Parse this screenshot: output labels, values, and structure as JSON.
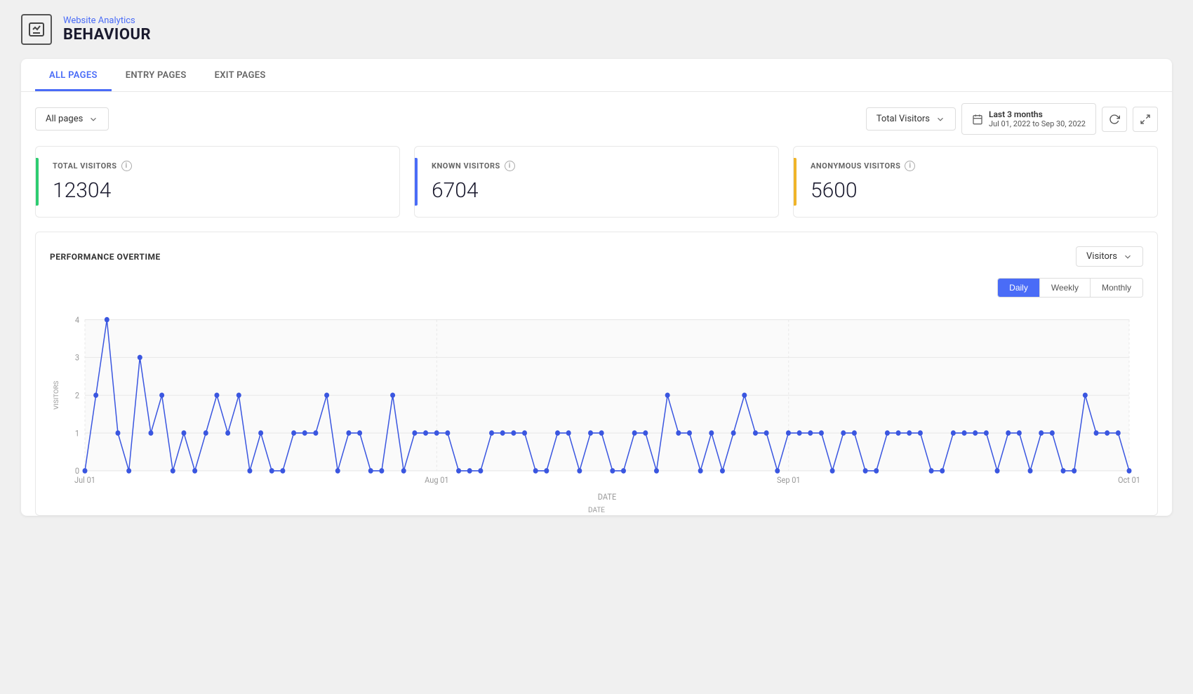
{
  "header": {
    "breadcrumb": "Website Analytics",
    "title": "BEHAVIOUR",
    "icon": "chart-icon"
  },
  "tabs": [
    {
      "id": "all-pages",
      "label": "ALL PAGES",
      "active": true
    },
    {
      "id": "entry-pages",
      "label": "ENTRY PAGES",
      "active": false
    },
    {
      "id": "exit-pages",
      "label": "EXIT PAGES",
      "active": false
    }
  ],
  "controls": {
    "filter_label": "All pages",
    "metric_label": "Total Visitors",
    "date_range_title": "Last 3 months",
    "date_start": "Jul 01, 2022",
    "date_to": "to",
    "date_end": "Sep 30, 2022"
  },
  "stats": [
    {
      "id": "total-visitors",
      "label": "TOTAL VISITORS",
      "value": "12304",
      "color": "green"
    },
    {
      "id": "known-visitors",
      "label": "KNOWN VISITORS",
      "value": "6704",
      "color": "blue"
    },
    {
      "id": "anonymous-visitors",
      "label": "ANONYMOUS VISITORS",
      "value": "5600",
      "color": "yellow"
    }
  ],
  "performance": {
    "title": "PERFORMANCE OVERTIME",
    "metric_dropdown": "Visitors",
    "time_buttons": [
      {
        "id": "daily",
        "label": "Daily",
        "active": true
      },
      {
        "id": "weekly",
        "label": "Weekly",
        "active": false
      },
      {
        "id": "monthly",
        "label": "Monthly",
        "active": false
      }
    ],
    "chart": {
      "y_label": "VISITORS",
      "x_label": "DATE",
      "x_ticks": [
        "Jul 01",
        "Aug 01",
        "Sep 01",
        "Oct 01"
      ],
      "y_max": 4,
      "y_ticks": [
        0,
        1,
        2,
        3,
        4
      ],
      "data_points": [
        0,
        2,
        4,
        1,
        0,
        3,
        1,
        2,
        0,
        1,
        0,
        1,
        2,
        1,
        2,
        0,
        1,
        0,
        0,
        1,
        1,
        1,
        2,
        0,
        1,
        1,
        0,
        0,
        2,
        0,
        1,
        1,
        1,
        1,
        0,
        0,
        0,
        1,
        1,
        1,
        1,
        0,
        0,
        1,
        1,
        0,
        1,
        1,
        0,
        0,
        1,
        1,
        0,
        2,
        1,
        1,
        0,
        1,
        0,
        1,
        2,
        1,
        1,
        0,
        1,
        1,
        1,
        1,
        0,
        1,
        1,
        0,
        0,
        1,
        1,
        1,
        1,
        0,
        0,
        1,
        1,
        1,
        1,
        0,
        1,
        1,
        0,
        1,
        1,
        0,
        0,
        2,
        1,
        1,
        1,
        0
      ]
    }
  }
}
